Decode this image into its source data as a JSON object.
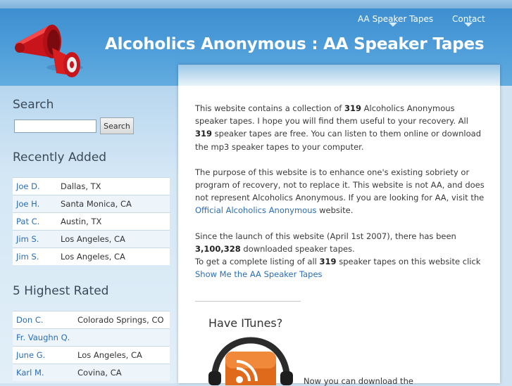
{
  "nav": {
    "items": [
      {
        "label": "AA Speaker Tapes"
      },
      {
        "label": "Contact"
      }
    ]
  },
  "site": {
    "title": "Alcoholics Anonymous : AA Speaker Tapes"
  },
  "sidebar": {
    "search": {
      "heading": "Search",
      "input_value": "",
      "button_label": "Search"
    },
    "recently_added": {
      "heading": "Recently Added",
      "rows": [
        {
          "name": "Joe D.",
          "location": "Dallas, TX"
        },
        {
          "name": "Joe H.",
          "location": "Santa Monica, CA"
        },
        {
          "name": "Pat C.",
          "location": "Austin, TX"
        },
        {
          "name": "Jim S.",
          "location": "Los Angeles, CA"
        },
        {
          "name": "Jim S.",
          "location": "Los Angeles, CA"
        }
      ]
    },
    "highest_rated": {
      "heading": "5 Highest Rated",
      "rows": [
        {
          "name": "Don C.",
          "location": "Colorado Springs, CO"
        },
        {
          "name": "Fr. Vaughn Q.",
          "location": ""
        },
        {
          "name": "June G.",
          "location": "Los Angeles, CA"
        },
        {
          "name": "Karl M.",
          "location": "Covina, CA"
        }
      ]
    }
  },
  "main": {
    "intro": {
      "before_count": "This website contains a collection of ",
      "count": "319",
      "middle": " Alcoholics Anonymous speaker tapes. I hope you will find them useful to your recovery. All ",
      "count2": "319",
      "after": " speaker tapes are free. You can listen to them online or download the mp3 speaker tapes to your computer."
    },
    "purpose": {
      "text": "The purpose of this website is to enhance one's existing sobriety or program of recovery, not to replace it. This website is not AA, and does not represent Alcoholics Anonymous. If you are looking for AA, visit the ",
      "link": "Official Alcoholics Anonymous",
      "after": " website."
    },
    "launch": {
      "text": "Since the launch of this website (April 1st 2007), there has been ",
      "downloads": "3,100,328",
      "after": " downloaded speaker tapes.",
      "listing_before": "To get a complete listing of all ",
      "listing_count": "319",
      "listing_after": " speaker tapes on this website click",
      "link": "Show Me the AA Speaker Tapes"
    },
    "itunes": {
      "heading": "Have ITunes?",
      "text": "Now you can download the"
    }
  },
  "colors": {
    "header_blue": "#4a9ad8",
    "link_blue": "#2a6db5",
    "megaphone_red": "#d81e1e"
  },
  "icons": [
    "megaphone-logo",
    "podcast-headphones-icon"
  ]
}
